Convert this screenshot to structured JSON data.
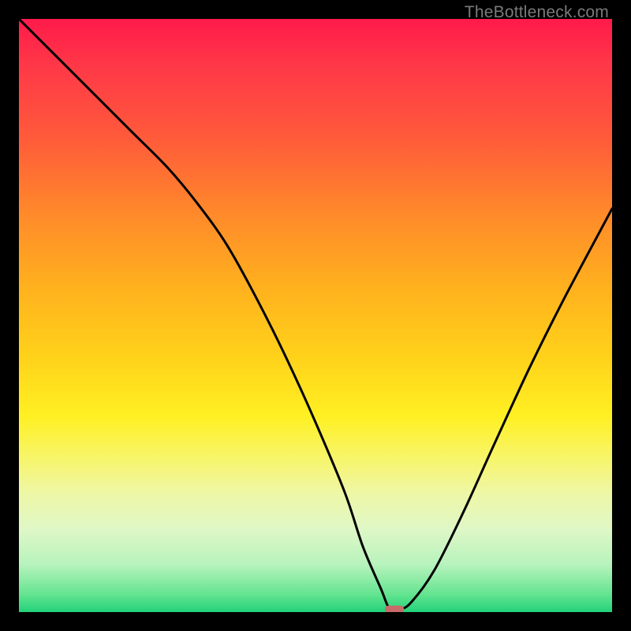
{
  "watermark": "TheBottleneck.com",
  "chart_data": {
    "type": "line",
    "title": "",
    "xlabel": "",
    "ylabel": "",
    "xlim": [
      0,
      100
    ],
    "ylim": [
      0,
      100
    ],
    "grid": false,
    "legend": false,
    "background": "rainbow-vertical-gradient",
    "series": [
      {
        "name": "bottleneck-curve",
        "x": [
          0,
          6,
          12,
          19,
          25,
          30,
          35,
          40,
          45,
          50,
          55,
          58,
          61,
          62.5,
          64,
          66,
          70,
          75,
          80,
          86,
          92,
          100
        ],
        "values": [
          100,
          94,
          88,
          81,
          75,
          69,
          62,
          53,
          43,
          32,
          20,
          11,
          4,
          0.5,
          0.5,
          1.5,
          7,
          17,
          28,
          41,
          53,
          68
        ],
        "color": "#000000",
        "stroke_width": 3
      }
    ],
    "marker": {
      "name": "optimal-range",
      "shape": "rounded-rect",
      "x_center": 63.3,
      "y": 0.5,
      "width_x": 3.2,
      "height_y": 1.2,
      "fill": "#c86a6a"
    }
  }
}
